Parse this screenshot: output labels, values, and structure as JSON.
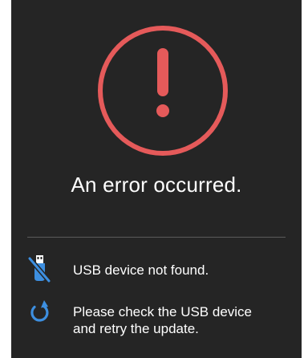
{
  "error": {
    "icon": "alert-circle-icon",
    "title": "An error occurred.",
    "accent_color": "#e55a5a"
  },
  "messages": [
    {
      "icon": "usb-off-icon",
      "icon_color": "#3d8fe0",
      "lines": [
        "USB device not found."
      ]
    },
    {
      "icon": "retry-icon",
      "icon_color": "#3d8fe0",
      "lines": [
        "Please check the USB device",
        "and retry the update."
      ]
    }
  ]
}
